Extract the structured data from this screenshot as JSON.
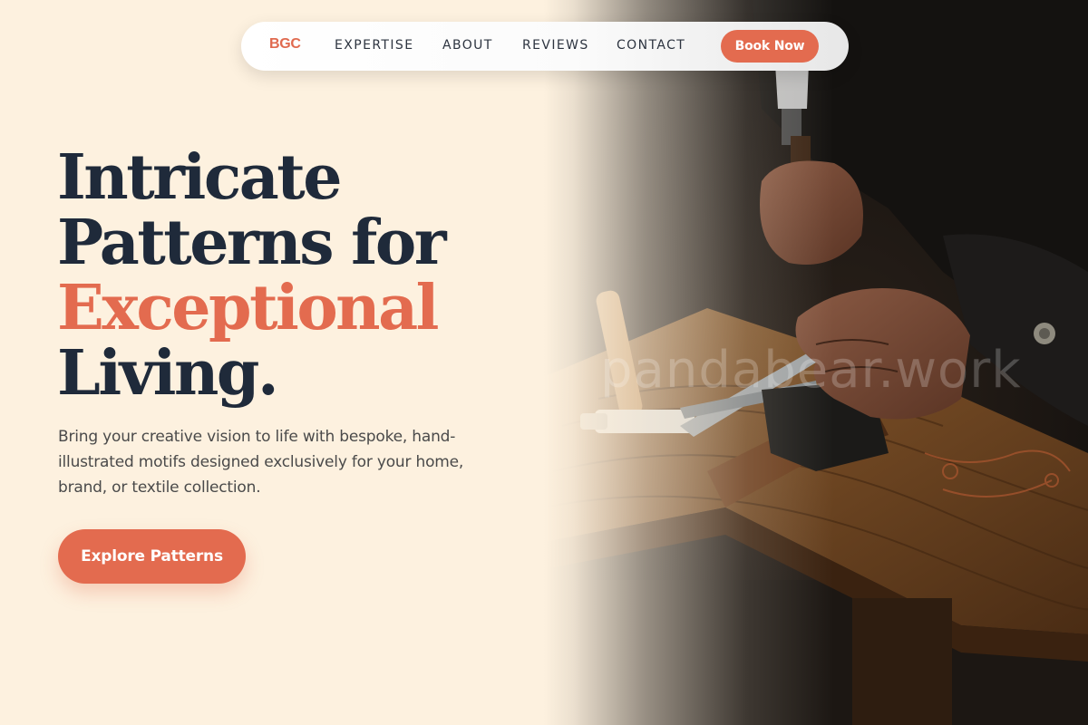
{
  "nav": {
    "logo": "BGC",
    "links": [
      "EXPERTISE",
      "ABOUT",
      "REVIEWS",
      "CONTACT"
    ],
    "cta": "Book Now"
  },
  "hero": {
    "title_line1": "Intricate",
    "title_line2": "Patterns for",
    "title_accent": "Exceptional",
    "title_line4": "Living.",
    "subtitle": "Bring your creative vision to life with bespoke, hand-illustrated motifs designed exclusively for your home, brand, or textile collection.",
    "cta": "Explore Patterns"
  },
  "image": {
    "subject": "craftsman hands working with hammer and pliers on wooden workbench",
    "watermark": "pandabear.work"
  },
  "colors": {
    "background": "#fdf1df",
    "accent": "#e36b4f",
    "heading": "#1f2a3a",
    "body_text": "#4a4a4a"
  }
}
